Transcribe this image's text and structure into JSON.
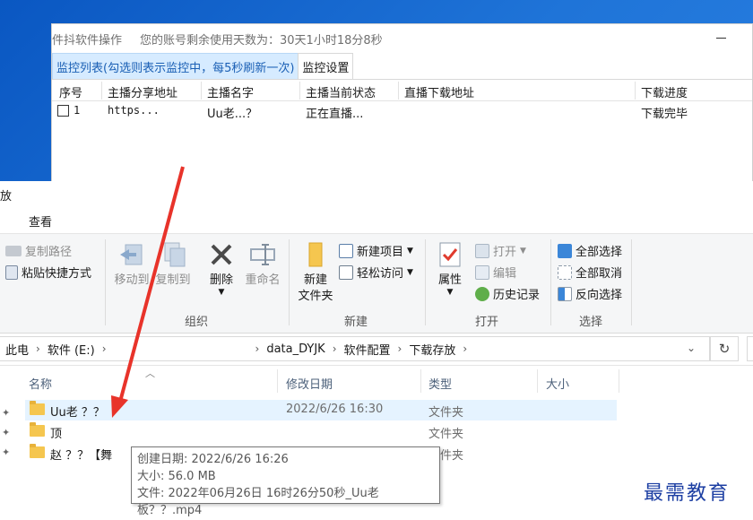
{
  "monitor_window": {
    "title": "件抖软件操作",
    "account_notice": "您的账号剩余使用天数为：30天1小时18分8秒",
    "tabs": [
      {
        "label": "监控列表(勾选则表示监控中，每5秒刷新一次)",
        "active": true
      },
      {
        "label": "监控设置",
        "active": false
      }
    ],
    "columns": [
      "序号",
      "主播分享地址",
      "主播名字",
      "主播当前状态",
      "直播下载地址",
      "下载进度"
    ],
    "rows": [
      {
        "index": "1",
        "share_url": "https...",
        "name": "Uu老...？",
        "status": "正在直播...",
        "download_url": "",
        "progress": "下载完毕",
        "checked": false
      }
    ]
  },
  "explorer": {
    "window_title": "放",
    "ribbon_tab": "查看",
    "groups": {
      "clipboard": {
        "copy_path": "复制路径",
        "paste_shortcut": "粘贴快捷方式"
      },
      "organize": {
        "label": "组织",
        "move_to": "移动到",
        "copy_to": "复制到",
        "delete": "删除",
        "rename": "重命名"
      },
      "new": {
        "label": "新建",
        "new_item": "新建项目",
        "easy_access": "轻松访问",
        "new_folder": "新建\n文件夹"
      },
      "open": {
        "label": "打开",
        "open": "打开",
        "edit": "编辑",
        "history": "历史记录",
        "properties": "属性"
      },
      "select": {
        "label": "选择",
        "select_all": "全部选择",
        "select_none": "全部取消",
        "invert": "反向选择"
      }
    },
    "breadcrumbs": [
      "此电",
      "软件 (E:)",
      "data_DYJK",
      "软件配置",
      "下载存放"
    ],
    "columns": {
      "name": "名称",
      "modified": "修改日期",
      "type": "类型",
      "size": "大小"
    },
    "files": [
      {
        "name": "Uu老 ？？",
        "modified": "2022/6/26 16:30",
        "type": "文件夹",
        "selected": true
      },
      {
        "name": "顶",
        "modified": "",
        "type": "文件夹",
        "selected": false
      },
      {
        "name": "赵 ？？【舞",
        "modified": "",
        "type": "文件夹",
        "selected": false
      }
    ],
    "tooltip": {
      "created": "创建日期: 2022/6/26 16:26",
      "size": "大小: 56.0 MB",
      "files": "文件: 2022年06月26日 16时26分50秒_Uu老板？？.mp4"
    }
  },
  "watermark": "最需教育",
  "colors": {
    "accent": "#1a5fb4",
    "selected_row": "#e5f3ff",
    "arrow": "#e8332a",
    "desktop": "#1f74d8"
  }
}
